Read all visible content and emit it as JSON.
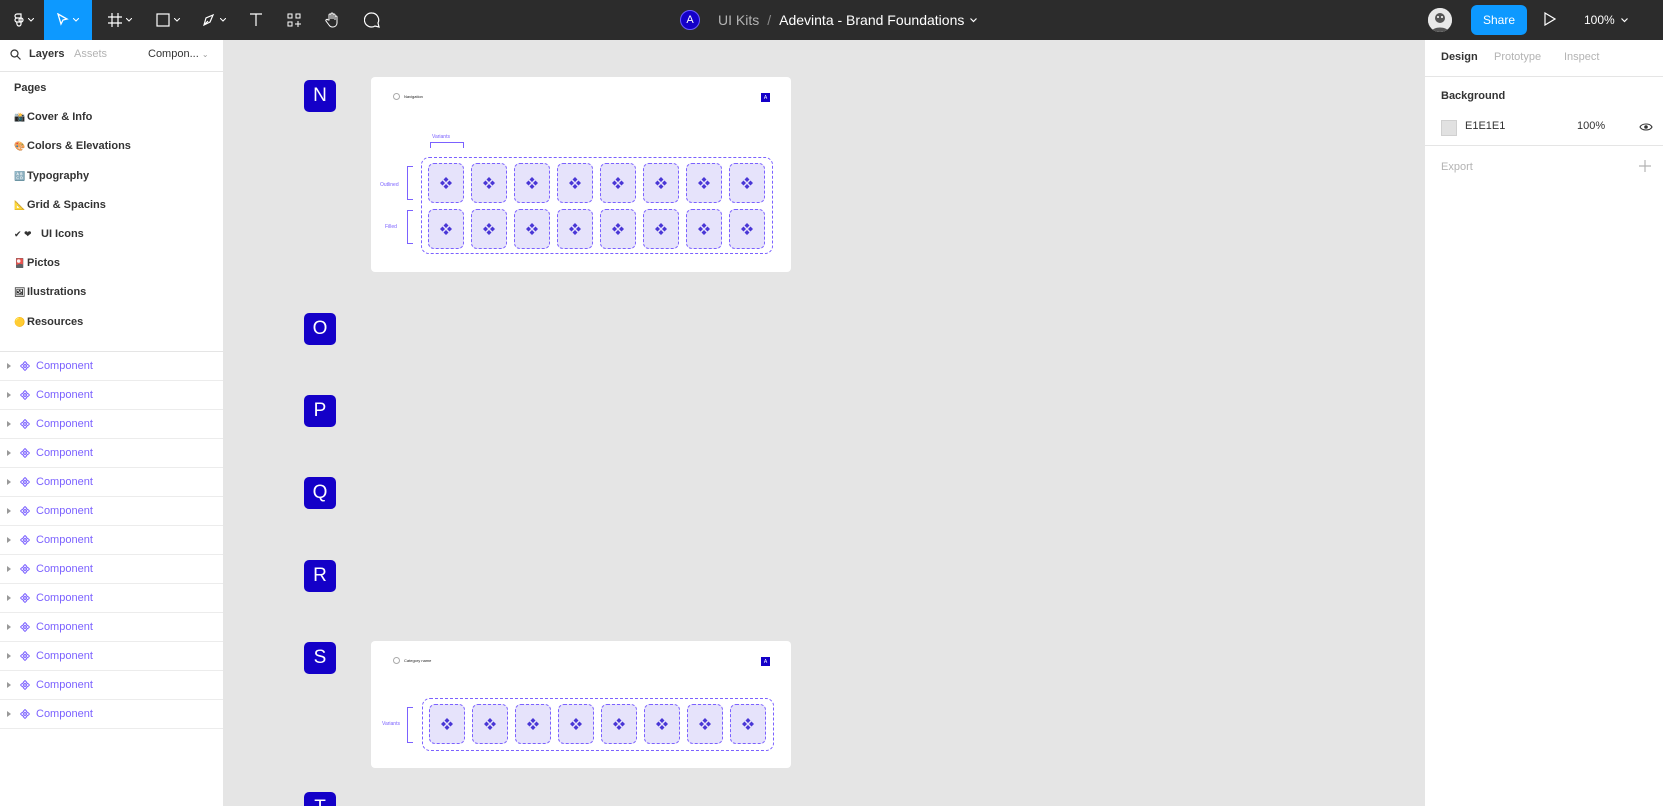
{
  "toolbar": {
    "project": "UI Kits",
    "separator": "/",
    "file_name": "Adevinta - Brand Foundations",
    "team_avatar": "A",
    "share_label": "Share",
    "zoom": "100%",
    "tools": [
      "figma-menu-icon",
      "move-tool-icon",
      "frame-tool-icon",
      "shape-tool-icon",
      "pen-tool-icon",
      "text-tool-icon",
      "resources-icon",
      "hand-tool-icon",
      "comment-icon"
    ]
  },
  "left_panel": {
    "tabs": {
      "layers": "Layers",
      "assets": "Assets",
      "page_select": "Compon..."
    },
    "pages_title": "Pages",
    "pages": [
      {
        "emoji": "📸",
        "label": "Cover & Info"
      },
      {
        "emoji": "🎨",
        "label": "Colors & Elevations"
      },
      {
        "emoji": "🔠",
        "label": "Typography"
      },
      {
        "emoji": "📐",
        "label": "Grid & Spacins"
      },
      {
        "emoji": "✔ ❤",
        "label": "UI Icons"
      },
      {
        "emoji": "🎴",
        "label": "Pictos"
      },
      {
        "emoji": "🖼",
        "label": "Ilustrations"
      },
      {
        "emoji": "🟡",
        "label": "Resources"
      }
    ],
    "layers": [
      "Component",
      "Component",
      "Component",
      "Component",
      "Component",
      "Component",
      "Component",
      "Component",
      "Component",
      "Component",
      "Component",
      "Component",
      "Component"
    ]
  },
  "right_panel": {
    "tabs": {
      "design": "Design",
      "prototype": "Prototype",
      "inspect": "Inspect"
    },
    "background_title": "Background",
    "background_hex": "E1E1E1",
    "background_color": "#e1e1e1",
    "background_opacity": "100%",
    "export_title": "Export"
  },
  "canvas": {
    "letters": [
      "N",
      "O",
      "P",
      "Q",
      "R",
      "S",
      "T"
    ],
    "frame1": {
      "title": "Navigation",
      "badge": "A",
      "top_label": "Variants",
      "row_labels": [
        "Outlined",
        "Filled"
      ]
    },
    "frame2": {
      "title": "Category name",
      "badge": "A",
      "row_label": "Variants"
    }
  },
  "colors": {
    "accent": "#0d99ff",
    "brand": "#1400c8",
    "component": "#7b61ff",
    "toolbar": "#2c2c2c",
    "canvas": "#e5e5e5"
  }
}
